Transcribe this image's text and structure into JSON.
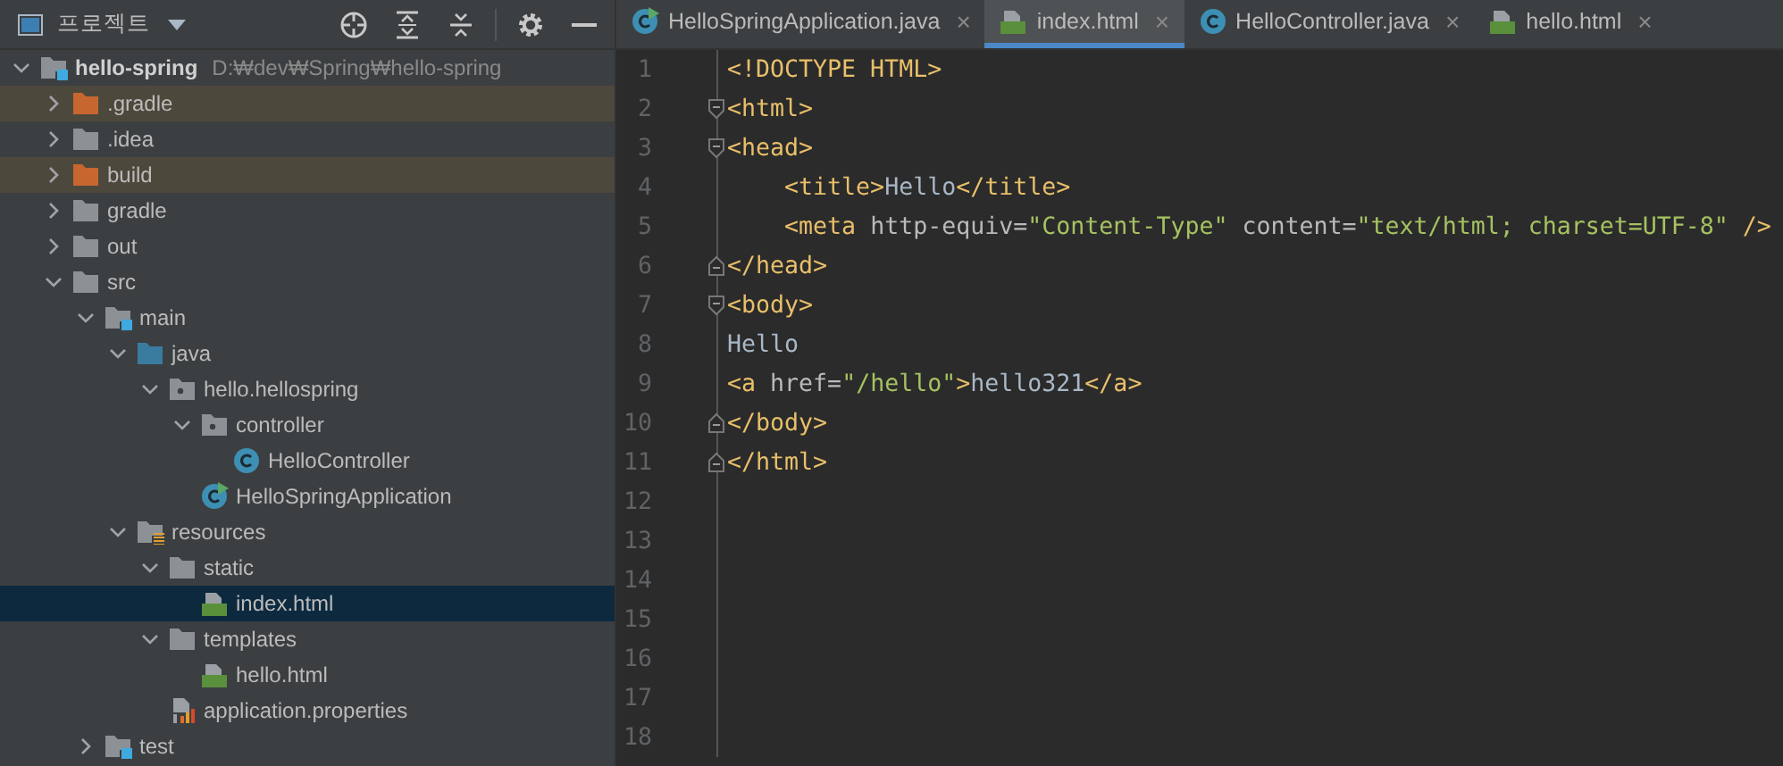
{
  "project_panel": {
    "title": "프로젝트"
  },
  "tree": [
    {
      "name": "hello-spring",
      "path": "D:₩dev₩Spring₩hello-spring",
      "kind": "module",
      "expanded": true,
      "selected": false,
      "children": [
        {
          "name": ".gradle",
          "kind": "excluded",
          "expanded": false,
          "selected": false
        },
        {
          "name": ".idea",
          "kind": "folder",
          "expanded": false,
          "selected": false
        },
        {
          "name": "build",
          "kind": "excluded",
          "expanded": false,
          "selected": false
        },
        {
          "name": "gradle",
          "kind": "folder",
          "expanded": false,
          "selected": false
        },
        {
          "name": "out",
          "kind": "folder",
          "expanded": false,
          "selected": false
        },
        {
          "name": "src",
          "kind": "folder",
          "expanded": true,
          "selected": false,
          "children": [
            {
              "name": "main",
              "kind": "module",
              "expanded": true,
              "selected": false,
              "children": [
                {
                  "name": "java",
                  "kind": "source",
                  "expanded": true,
                  "selected": false,
                  "children": [
                    {
                      "name": "hello.hellospring",
                      "kind": "package",
                      "expanded": true,
                      "selected": false,
                      "children": [
                        {
                          "name": "controller",
                          "kind": "package",
                          "expanded": true,
                          "selected": false,
                          "children": [
                            {
                              "name": "HelloController",
                              "kind": "class",
                              "selected": false
                            }
                          ]
                        },
                        {
                          "name": "HelloSpringApplication",
                          "kind": "app",
                          "selected": false
                        }
                      ]
                    }
                  ]
                },
                {
                  "name": "resources",
                  "kind": "resources",
                  "expanded": true,
                  "selected": false,
                  "children": [
                    {
                      "name": "static",
                      "kind": "folder",
                      "expanded": true,
                      "selected": false,
                      "children": [
                        {
                          "name": "index.html",
                          "kind": "html",
                          "selected": true
                        }
                      ]
                    },
                    {
                      "name": "templates",
                      "kind": "folder",
                      "expanded": true,
                      "selected": false,
                      "children": [
                        {
                          "name": "hello.html",
                          "kind": "html",
                          "selected": false
                        }
                      ]
                    },
                    {
                      "name": "application.properties",
                      "kind": "properties",
                      "selected": false
                    }
                  ]
                }
              ]
            },
            {
              "name": "test",
              "kind": "module",
              "expanded": false,
              "selected": false
            }
          ]
        }
      ]
    }
  ],
  "tabs": [
    {
      "label": "HelloSpringApplication.java",
      "kind": "app",
      "selected": false
    },
    {
      "label": "index.html",
      "kind": "html",
      "selected": true
    },
    {
      "label": "HelloController.java",
      "kind": "class",
      "selected": false
    },
    {
      "label": "hello.html",
      "kind": "html",
      "selected": false
    }
  ],
  "close_glyph": "×",
  "lines": [
    {
      "number": "1",
      "kind": "plain",
      "segments": [
        {
          "kind": "tag",
          "text": "<!DOCTYPE HTML>"
        }
      ]
    },
    {
      "number": "2",
      "kind": "fold-start",
      "segments": [
        {
          "kind": "tag",
          "text": "<html>"
        }
      ]
    },
    {
      "number": "3",
      "kind": "fold-start",
      "segments": [
        {
          "kind": "tag",
          "text": "<head>"
        }
      ]
    },
    {
      "number": "4",
      "kind": "plain",
      "segments": [
        {
          "kind": "tag",
          "text": "    <title>"
        },
        {
          "kind": "text",
          "text": "Hello"
        },
        {
          "kind": "tag",
          "text": "</title>"
        }
      ]
    },
    {
      "number": "5",
      "kind": "plain",
      "segments": [
        {
          "kind": "tag",
          "text": "    <meta"
        },
        {
          "kind": "attr",
          "text": " http-equiv="
        },
        {
          "kind": "string",
          "text": "\"Content-Type\""
        },
        {
          "kind": "attr",
          "text": " content="
        },
        {
          "kind": "string",
          "text": "\"text/html; charset=UTF-8\""
        },
        {
          "kind": "tag",
          "text": " />"
        }
      ]
    },
    {
      "number": "6",
      "kind": "fold-end",
      "segments": [
        {
          "kind": "tag",
          "text": "</head>"
        }
      ]
    },
    {
      "number": "7",
      "kind": "fold-start",
      "segments": [
        {
          "kind": "tag",
          "text": "<body>"
        }
      ]
    },
    {
      "number": "8",
      "kind": "plain",
      "segments": [
        {
          "kind": "text",
          "text": "Hello"
        }
      ]
    },
    {
      "number": "9",
      "kind": "plain",
      "segments": [
        {
          "kind": "tag",
          "text": "<a"
        },
        {
          "kind": "attr",
          "text": " href="
        },
        {
          "kind": "string",
          "text": "\"/hello\""
        },
        {
          "kind": "tag",
          "text": ">"
        },
        {
          "kind": "text",
          "text": "hello321"
        },
        {
          "kind": "tag",
          "text": "</a>"
        }
      ]
    },
    {
      "number": "10",
      "kind": "fold-end",
      "segments": [
        {
          "kind": "tag",
          "text": "</body>"
        }
      ]
    },
    {
      "number": "11",
      "kind": "fold-end",
      "segments": [
        {
          "kind": "tag",
          "text": "</html>"
        }
      ]
    },
    {
      "number": "12",
      "kind": "plain"
    },
    {
      "number": "13",
      "kind": "plain"
    },
    {
      "number": "14",
      "kind": "plain"
    },
    {
      "number": "15",
      "kind": "plain"
    },
    {
      "number": "16",
      "kind": "plain"
    },
    {
      "number": "17",
      "kind": "plain"
    },
    {
      "number": "18",
      "kind": "plain"
    }
  ]
}
